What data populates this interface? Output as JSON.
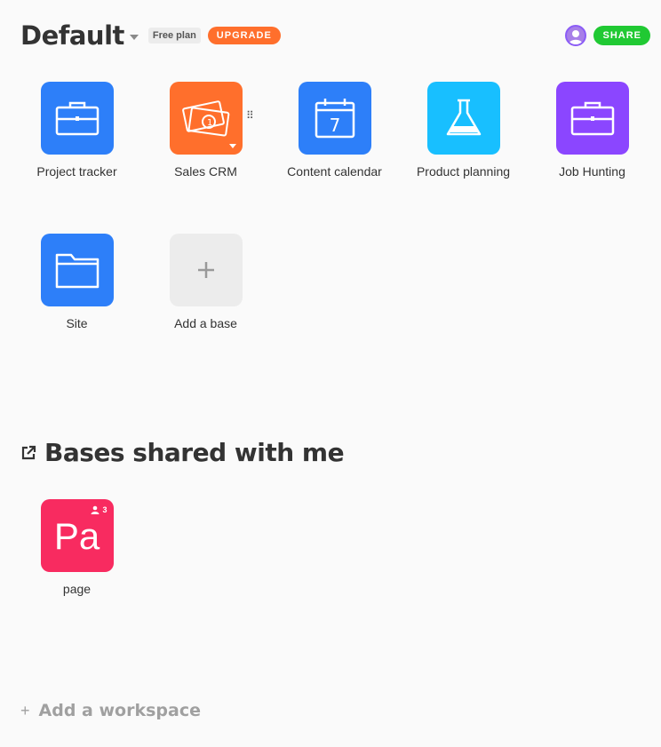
{
  "workspace": {
    "title": "Default",
    "plan_badge": "Free plan",
    "upgrade_label": "UPGRADE",
    "share_label": "SHARE"
  },
  "bases": [
    {
      "label": "Project tracker",
      "icon": "briefcase-icon",
      "color": "#2d7ff9"
    },
    {
      "label": "Sales CRM",
      "icon": "money-icon",
      "color": "#ff6f2c"
    },
    {
      "label": "Content calendar",
      "icon": "calendar-icon",
      "color": "#2d7ff9",
      "calendar_day": "7"
    },
    {
      "label": "Product planning",
      "icon": "flask-icon",
      "color": "#18bfff"
    },
    {
      "label": "Job Hunting",
      "icon": "briefcase-icon",
      "color": "#8b46ff"
    },
    {
      "label": "Site",
      "icon": "folder-icon",
      "color": "#2d7ff9"
    }
  ],
  "add_base": {
    "label": "Add a base",
    "icon": "plus-icon"
  },
  "shared": {
    "title": "Bases shared with me",
    "bases": [
      {
        "label": "page",
        "abbr": "Pa",
        "color": "#f82b60",
        "collaborators": "3"
      }
    ]
  },
  "add_workspace": {
    "label": "Add a workspace"
  }
}
